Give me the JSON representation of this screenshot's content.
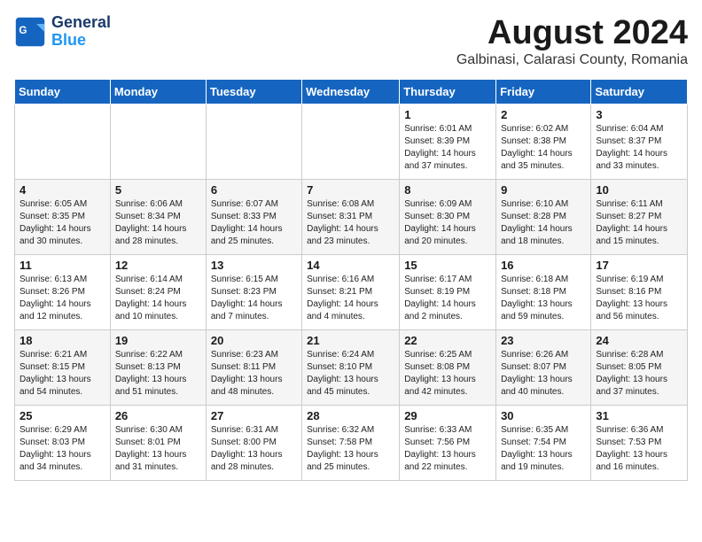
{
  "header": {
    "logo_line1": "General",
    "logo_line2": "Blue",
    "month_year": "August 2024",
    "location": "Galbinasi, Calarasi County, Romania"
  },
  "weekdays": [
    "Sunday",
    "Monday",
    "Tuesday",
    "Wednesday",
    "Thursday",
    "Friday",
    "Saturday"
  ],
  "weeks": [
    [
      {
        "day": "",
        "info": ""
      },
      {
        "day": "",
        "info": ""
      },
      {
        "day": "",
        "info": ""
      },
      {
        "day": "",
        "info": ""
      },
      {
        "day": "1",
        "info": "Sunrise: 6:01 AM\nSunset: 8:39 PM\nDaylight: 14 hours\nand 37 minutes."
      },
      {
        "day": "2",
        "info": "Sunrise: 6:02 AM\nSunset: 8:38 PM\nDaylight: 14 hours\nand 35 minutes."
      },
      {
        "day": "3",
        "info": "Sunrise: 6:04 AM\nSunset: 8:37 PM\nDaylight: 14 hours\nand 33 minutes."
      }
    ],
    [
      {
        "day": "4",
        "info": "Sunrise: 6:05 AM\nSunset: 8:35 PM\nDaylight: 14 hours\nand 30 minutes."
      },
      {
        "day": "5",
        "info": "Sunrise: 6:06 AM\nSunset: 8:34 PM\nDaylight: 14 hours\nand 28 minutes."
      },
      {
        "day": "6",
        "info": "Sunrise: 6:07 AM\nSunset: 8:33 PM\nDaylight: 14 hours\nand 25 minutes."
      },
      {
        "day": "7",
        "info": "Sunrise: 6:08 AM\nSunset: 8:31 PM\nDaylight: 14 hours\nand 23 minutes."
      },
      {
        "day": "8",
        "info": "Sunrise: 6:09 AM\nSunset: 8:30 PM\nDaylight: 14 hours\nand 20 minutes."
      },
      {
        "day": "9",
        "info": "Sunrise: 6:10 AM\nSunset: 8:28 PM\nDaylight: 14 hours\nand 18 minutes."
      },
      {
        "day": "10",
        "info": "Sunrise: 6:11 AM\nSunset: 8:27 PM\nDaylight: 14 hours\nand 15 minutes."
      }
    ],
    [
      {
        "day": "11",
        "info": "Sunrise: 6:13 AM\nSunset: 8:26 PM\nDaylight: 14 hours\nand 12 minutes."
      },
      {
        "day": "12",
        "info": "Sunrise: 6:14 AM\nSunset: 8:24 PM\nDaylight: 14 hours\nand 10 minutes."
      },
      {
        "day": "13",
        "info": "Sunrise: 6:15 AM\nSunset: 8:23 PM\nDaylight: 14 hours\nand 7 minutes."
      },
      {
        "day": "14",
        "info": "Sunrise: 6:16 AM\nSunset: 8:21 PM\nDaylight: 14 hours\nand 4 minutes."
      },
      {
        "day": "15",
        "info": "Sunrise: 6:17 AM\nSunset: 8:19 PM\nDaylight: 14 hours\nand 2 minutes."
      },
      {
        "day": "16",
        "info": "Sunrise: 6:18 AM\nSunset: 8:18 PM\nDaylight: 13 hours\nand 59 minutes."
      },
      {
        "day": "17",
        "info": "Sunrise: 6:19 AM\nSunset: 8:16 PM\nDaylight: 13 hours\nand 56 minutes."
      }
    ],
    [
      {
        "day": "18",
        "info": "Sunrise: 6:21 AM\nSunset: 8:15 PM\nDaylight: 13 hours\nand 54 minutes."
      },
      {
        "day": "19",
        "info": "Sunrise: 6:22 AM\nSunset: 8:13 PM\nDaylight: 13 hours\nand 51 minutes."
      },
      {
        "day": "20",
        "info": "Sunrise: 6:23 AM\nSunset: 8:11 PM\nDaylight: 13 hours\nand 48 minutes."
      },
      {
        "day": "21",
        "info": "Sunrise: 6:24 AM\nSunset: 8:10 PM\nDaylight: 13 hours\nand 45 minutes."
      },
      {
        "day": "22",
        "info": "Sunrise: 6:25 AM\nSunset: 8:08 PM\nDaylight: 13 hours\nand 42 minutes."
      },
      {
        "day": "23",
        "info": "Sunrise: 6:26 AM\nSunset: 8:07 PM\nDaylight: 13 hours\nand 40 minutes."
      },
      {
        "day": "24",
        "info": "Sunrise: 6:28 AM\nSunset: 8:05 PM\nDaylight: 13 hours\nand 37 minutes."
      }
    ],
    [
      {
        "day": "25",
        "info": "Sunrise: 6:29 AM\nSunset: 8:03 PM\nDaylight: 13 hours\nand 34 minutes."
      },
      {
        "day": "26",
        "info": "Sunrise: 6:30 AM\nSunset: 8:01 PM\nDaylight: 13 hours\nand 31 minutes."
      },
      {
        "day": "27",
        "info": "Sunrise: 6:31 AM\nSunset: 8:00 PM\nDaylight: 13 hours\nand 28 minutes."
      },
      {
        "day": "28",
        "info": "Sunrise: 6:32 AM\nSunset: 7:58 PM\nDaylight: 13 hours\nand 25 minutes."
      },
      {
        "day": "29",
        "info": "Sunrise: 6:33 AM\nSunset: 7:56 PM\nDaylight: 13 hours\nand 22 minutes."
      },
      {
        "day": "30",
        "info": "Sunrise: 6:35 AM\nSunset: 7:54 PM\nDaylight: 13 hours\nand 19 minutes."
      },
      {
        "day": "31",
        "info": "Sunrise: 6:36 AM\nSunset: 7:53 PM\nDaylight: 13 hours\nand 16 minutes."
      }
    ]
  ]
}
